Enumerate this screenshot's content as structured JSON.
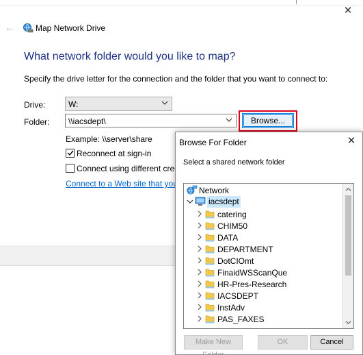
{
  "wizard": {
    "title": "Map Network Drive",
    "close_glyph": "✕",
    "back_glyph": "←",
    "icon": "network-drive-icon",
    "heading": "What network folder would you like to map?",
    "instruction": "Specify the drive letter for the connection and the folder that you want to connect to:",
    "drive_label": "Drive:",
    "drive_value": "W:",
    "folder_label": "Folder:",
    "folder_value": "\\\\iacsdept\\",
    "browse_label": "Browse...",
    "example": "Example: \\\\server\\share",
    "reconnect_label": "Reconnect at sign-in",
    "reconnect_checked": true,
    "credentials_label": "Connect using different credent",
    "credentials_checked": false,
    "web_link": "Connect to a Web site that you can",
    "highlight_color": "#e0001b",
    "accent_color": "#1e3287",
    "link_color": "#0066cc"
  },
  "browse_dialog": {
    "title": "Browse For Folder",
    "close_glyph": "✕",
    "prompt": "Select a shared network folder",
    "tree": {
      "root": {
        "label": "Network",
        "icon": "network-icon"
      },
      "server": {
        "label": "iacsdept",
        "icon": "computer-icon",
        "expanded": true,
        "selected": true
      },
      "folders": [
        {
          "label": "catering"
        },
        {
          "label": "CHIM50"
        },
        {
          "label": "DATA"
        },
        {
          "label": "DEPARTMENT"
        },
        {
          "label": "DotCIOmt"
        },
        {
          "label": "FinaidWSScanQue"
        },
        {
          "label": "HR-Pres-Research"
        },
        {
          "label": "IACSDEPT"
        },
        {
          "label": "InstAdv"
        },
        {
          "label": "PAS_FAXES"
        }
      ]
    },
    "buttons": {
      "make_folder": "Make New Folder",
      "ok": "OK",
      "cancel": "Cancel"
    }
  }
}
